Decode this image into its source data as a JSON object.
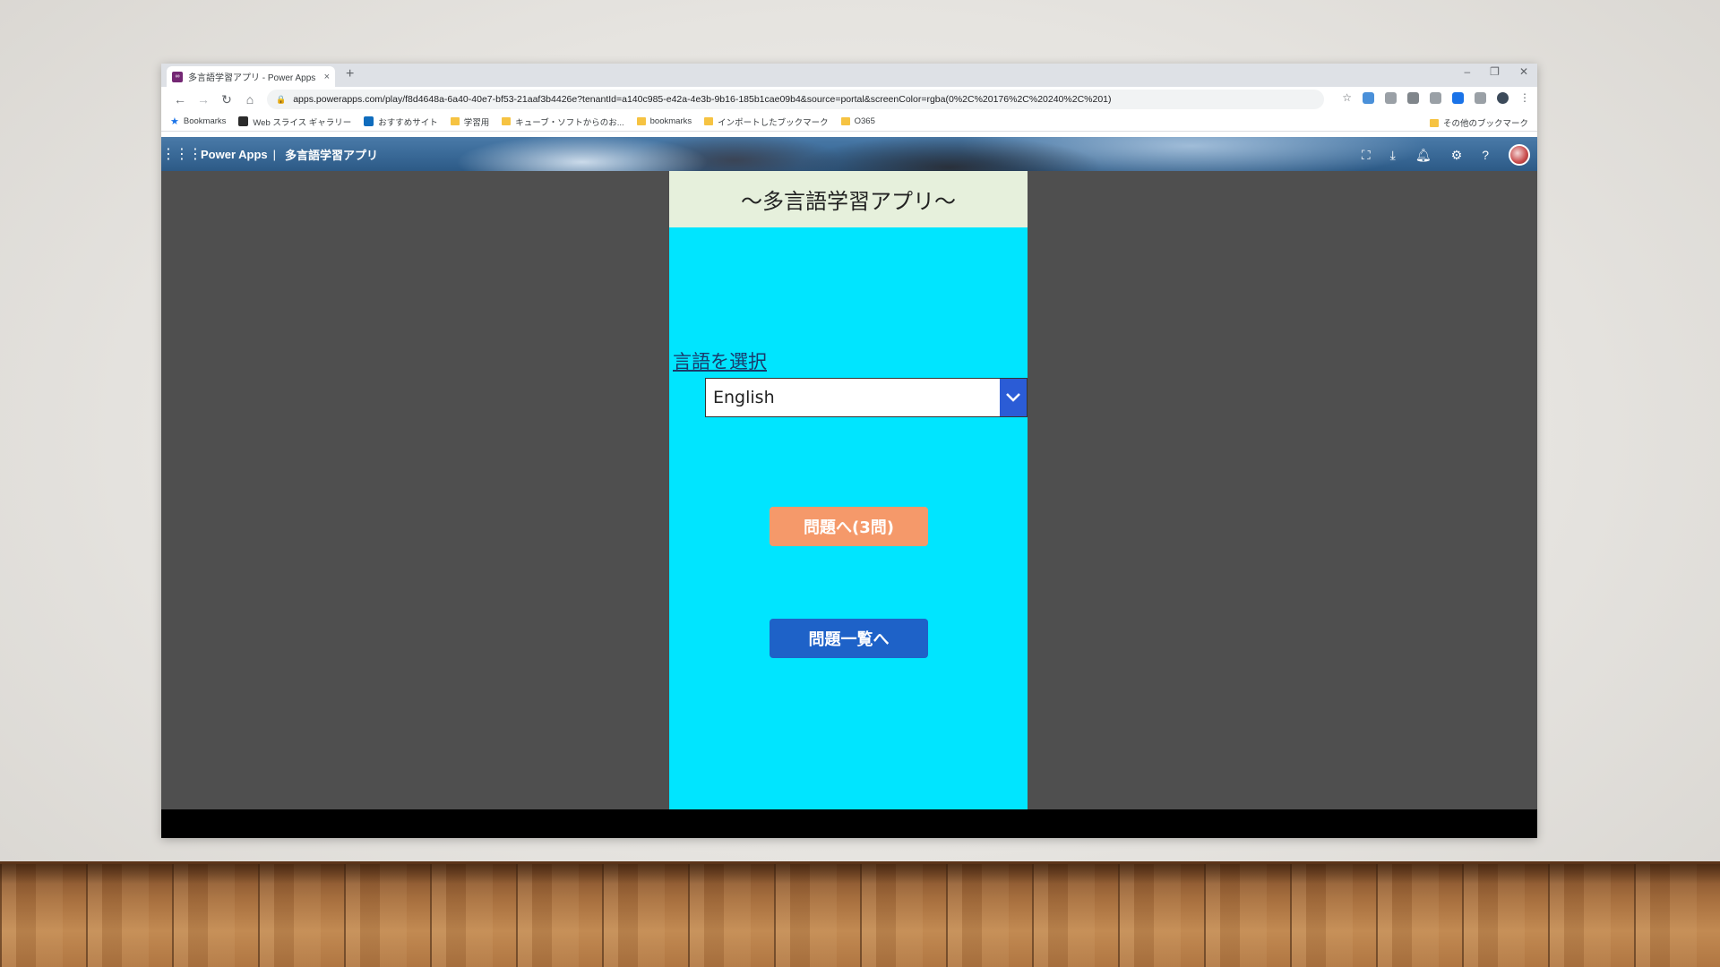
{
  "browser": {
    "tab_title": "多言語学習アプリ - Power Apps",
    "tab_close": "×",
    "new_tab": "+",
    "window_controls": [
      "–",
      "❐",
      "✕"
    ],
    "url": "apps.powerapps.com/play/f8d4648a-6a40-40e7-bf53-21aaf3b4426e?tenantId=a140c985-e42a-4e3b-9b16-185b1cae09b4&source=portal&screenColor=rgba(0%2C%20176%2C%20240%2C%201)",
    "bookmarks": [
      {
        "label": "Bookmarks",
        "icon": "star-icon"
      },
      {
        "label": "Web スライス ギャラリー",
        "icon": "web-slice-icon"
      },
      {
        "label": "おすすめサイト",
        "icon": "bing-icon"
      },
      {
        "label": "学習用",
        "icon": "folder-icon"
      },
      {
        "label": "キューブ・ソフトからのお...",
        "icon": "folder-icon"
      },
      {
        "label": "bookmarks",
        "icon": "folder-icon"
      },
      {
        "label": "インポートしたブックマーク",
        "icon": "folder-icon"
      },
      {
        "label": "O365",
        "icon": "folder-icon"
      }
    ],
    "other_bookmarks": "その他のブックマーク"
  },
  "powerapps": {
    "product": "Power Apps",
    "separator": "|",
    "app_name": "多言語学習アプリ",
    "header_icons": [
      "fullscreen-icon",
      "download-icon",
      "bell-icon",
      "gear-icon",
      "help-icon",
      "avatar"
    ]
  },
  "app": {
    "title": "～多言語学習アプリ～",
    "language_label": "言語を選択",
    "language_selected": "English",
    "quiz_button": "問題へ(3問)",
    "list_button": "問題一覧へ"
  },
  "colors": {
    "canvas": "#00e5ff",
    "title_bar": "#e6f0dc",
    "quiz_button": "#f5996a",
    "list_button": "#1e62c8",
    "dropdown_arrow": "#2b5cd6",
    "app_background": "#4f4f4f"
  }
}
